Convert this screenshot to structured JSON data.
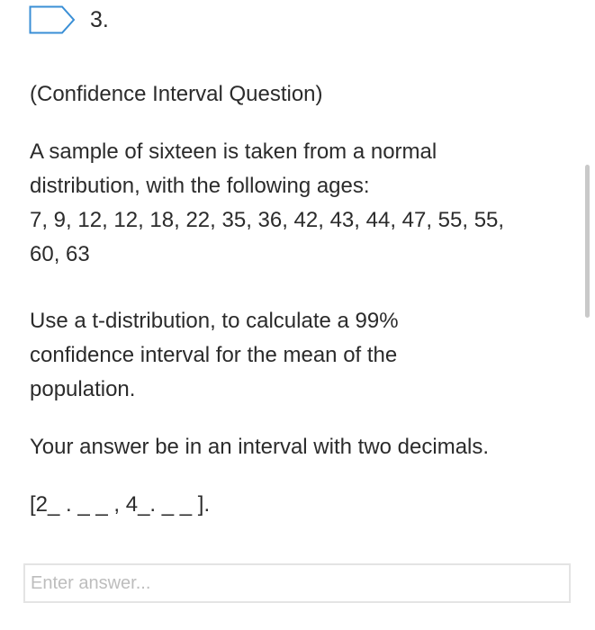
{
  "question": {
    "number": "3.",
    "type_label": "(Confidence Interval Question)",
    "sample_intro_line1": "A sample of sixteen is taken from a normal",
    "sample_intro_line2": "distribution, with the following ages:",
    "ages_line1": "7, 9, 12, 12, 18, 22, 35, 36, 42, 43, 44, 47, 55, 55,",
    "ages_line2": "60, 63",
    "task_line1": "Use a t-distribution, to calculate  a 99%",
    "task_line2": "confidence interval for the mean of the",
    "task_line3": "population.",
    "instruction": "Your answer be in an interval with two decimals.",
    "format_hint": "[2_ . _ _ ,  4_. _ _ ]."
  },
  "answer": {
    "value": "",
    "placeholder": "Enter answer..."
  },
  "colors": {
    "flag_outline": "#3a8fd6",
    "text": "#2b2b2b",
    "input_border": "#e4e4e4",
    "placeholder": "#bdbdbd",
    "scrollbar": "#c9c9c9"
  },
  "icons": {
    "flag": "bookmark-flag-icon"
  }
}
